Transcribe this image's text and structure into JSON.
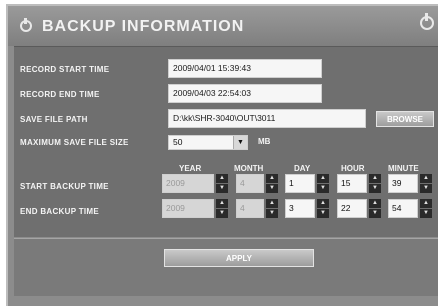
{
  "title": "BACKUP INFORMATION",
  "record_start": {
    "label": "RECORD START TIME",
    "value": "2009/04/01 15:39:43"
  },
  "record_end": {
    "label": "RECORD END TIME",
    "value": "2009/04/03 22:54:03"
  },
  "save_path": {
    "label": "SAVE FILE PATH",
    "value": "D:\\kk\\SHR-3040\\OUT\\3011",
    "browse": "BROWSE"
  },
  "max_size": {
    "label": "MAXIMUM SAVE FILE SIZE",
    "value": "50",
    "unit": "MB"
  },
  "columns": [
    "YEAR",
    "MONTH",
    "DAY",
    "HOUR",
    "MINUTE"
  ],
  "start_backup": {
    "label": "START BACKUP TIME",
    "year": "2009",
    "month": "4",
    "day": "1",
    "hour": "15",
    "minute": "39"
  },
  "end_backup": {
    "label": "END BACKUP TIME",
    "year": "2009",
    "month": "4",
    "day": "3",
    "hour": "22",
    "minute": "54"
  },
  "apply": "APPLY"
}
